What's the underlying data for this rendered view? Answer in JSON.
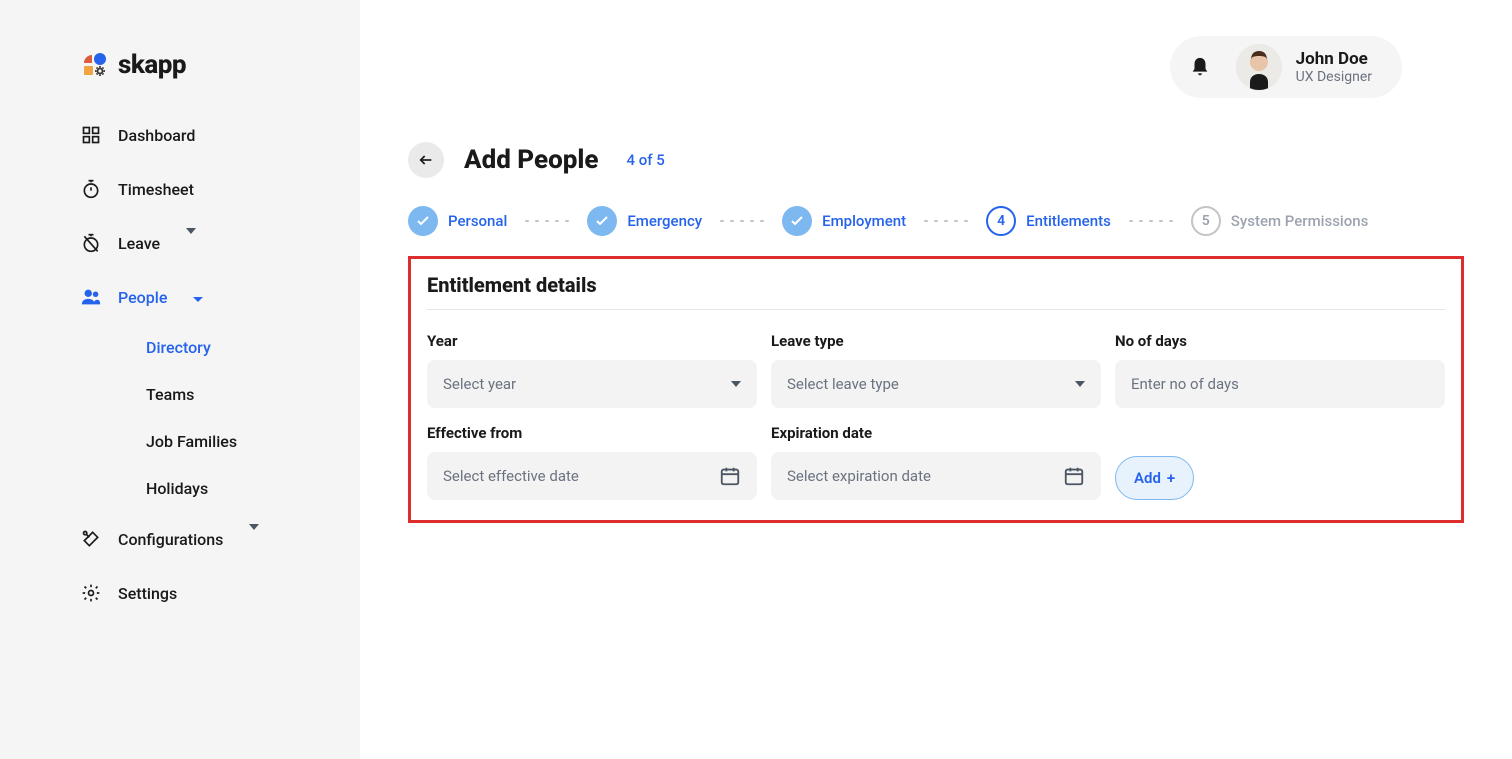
{
  "logo": {
    "text": "skapp"
  },
  "sidebar": {
    "items": [
      {
        "label": "Dashboard"
      },
      {
        "label": "Timesheet"
      },
      {
        "label": "Leave"
      },
      {
        "label": "People"
      },
      {
        "label": "Configurations"
      },
      {
        "label": "Settings"
      }
    ],
    "people_subitems": [
      {
        "label": "Directory"
      },
      {
        "label": "Teams"
      },
      {
        "label": "Job Families"
      },
      {
        "label": "Holidays"
      }
    ]
  },
  "header": {
    "user_name": "John Doe",
    "user_role": "UX Designer"
  },
  "page": {
    "title": "Add People",
    "step_indicator": "4 of 5"
  },
  "stepper": [
    {
      "label": "Personal",
      "state": "done"
    },
    {
      "label": "Emergency",
      "state": "done"
    },
    {
      "label": "Employment",
      "state": "done"
    },
    {
      "label": "Entitlements",
      "state": "current",
      "number": "4"
    },
    {
      "label": "System Permissions",
      "state": "todo",
      "number": "5"
    }
  ],
  "panel": {
    "title": "Entitlement details",
    "fields": {
      "year": {
        "label": "Year",
        "placeholder": "Select year"
      },
      "leave_type": {
        "label": "Leave type",
        "placeholder": "Select leave type"
      },
      "no_of_days": {
        "label": "No of days",
        "placeholder": "Enter no of days"
      },
      "effective_from": {
        "label": "Effective from",
        "placeholder": "Select effective date"
      },
      "expiration_date": {
        "label": "Expiration date",
        "placeholder": "Select expiration date"
      }
    },
    "add_button": "Add"
  }
}
